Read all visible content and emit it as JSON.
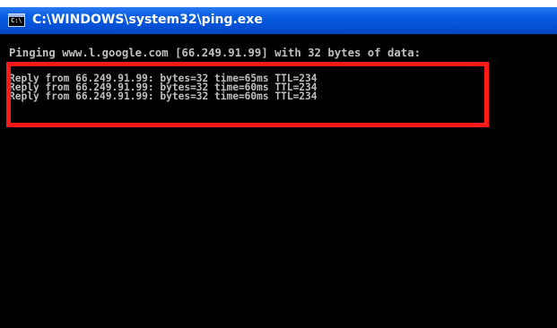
{
  "window": {
    "title": "C:\\WINDOWS\\system32\\ping.exe",
    "icon_label": "C:\\"
  },
  "console": {
    "lines": [
      "Pinging www.l.google.com [66.249.91.99] with 32 bytes of data:",
      "Reply from 66.249.91.99: bytes=32 time=65ms TTL=234",
      "Reply from 66.249.91.99: bytes=32 time=60ms TTL=234",
      "Reply from 66.249.91.99: bytes=32 time=60ms TTL=234"
    ]
  },
  "colors": {
    "titlebar": "#0550d6",
    "console_background": "#000000",
    "console_text": "#c0c0c0",
    "highlight": "#ff1a1a"
  },
  "icons": {
    "window_icon": "console-window-icon"
  }
}
